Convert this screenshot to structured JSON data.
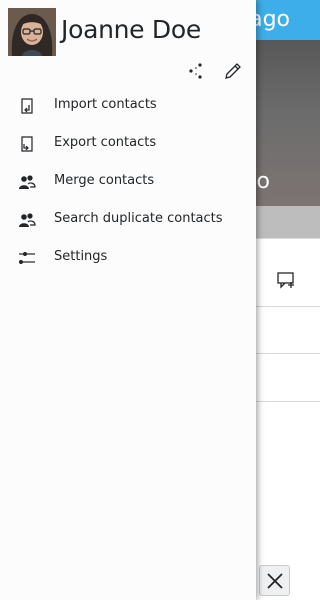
{
  "background": {
    "header_title_fragment": "ago",
    "hero_text_fragment": "o"
  },
  "drawer": {
    "user_name": "Joanne Doe",
    "actions": [
      {
        "name": "share-icon"
      },
      {
        "name": "edit-icon"
      }
    ],
    "menu": [
      {
        "label": "Import contacts",
        "icon": "import-icon"
      },
      {
        "label": "Export contacts",
        "icon": "export-icon"
      },
      {
        "label": "Merge contacts",
        "icon": "merge-contacts-icon"
      },
      {
        "label": "Search duplicate contacts",
        "icon": "search-duplicates-icon"
      },
      {
        "label": "Settings",
        "icon": "settings-icon"
      }
    ]
  },
  "colors": {
    "accent": "#3daee9",
    "drawer_bg": "#fcfcfc",
    "text": "#232629"
  }
}
